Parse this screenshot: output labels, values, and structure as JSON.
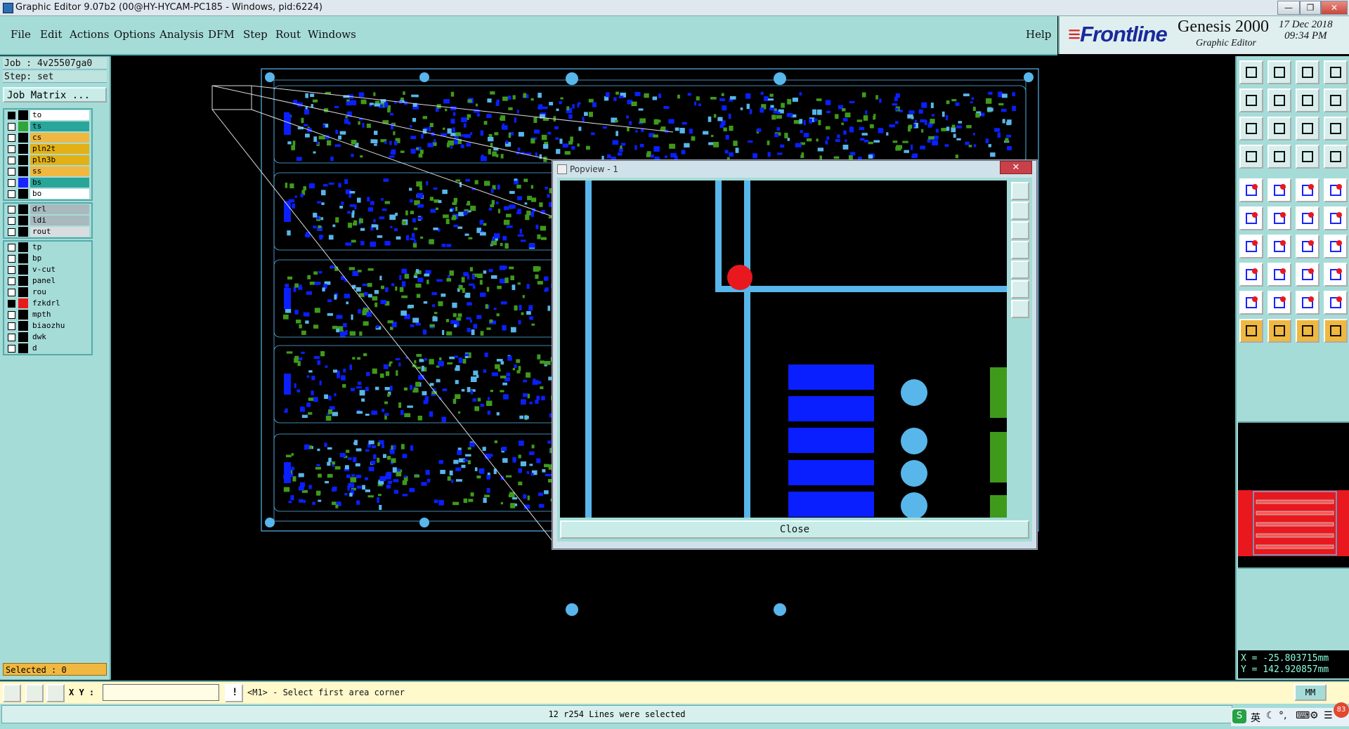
{
  "window": {
    "title": "Graphic Editor 9.07b2 (00@HY-HYCAM-PC185 - Windows, pid:6224)"
  },
  "menu": {
    "items": [
      "File",
      "Edit",
      "Actions",
      "Options",
      "Analysis",
      "DFM",
      "Step",
      "Rout",
      "Windows"
    ],
    "help": "Help"
  },
  "brand": {
    "logo": "Frontline",
    "product": "Genesis 2000",
    "subtitle": "Graphic Editor",
    "date": "17 Dec 2018",
    "time": "09:34 PM"
  },
  "job": {
    "job_line": "Job : 4v25507ga0",
    "step_line": "Step: set",
    "matrix_button": "Job Matrix ..."
  },
  "layers_group1": [
    {
      "name": "to",
      "checked": true,
      "color": "#000000",
      "bg": "#ffffff"
    },
    {
      "name": "ts",
      "checked": false,
      "color": "#2fa53c",
      "bg": "#2aa59a"
    },
    {
      "name": "cs",
      "checked": false,
      "color": "#000000",
      "bg": "#f0b840"
    },
    {
      "name": "pln2t",
      "checked": false,
      "color": "#000000",
      "bg": "#e3b015"
    },
    {
      "name": "pln3b",
      "checked": false,
      "color": "#000000",
      "bg": "#e3b015"
    },
    {
      "name": "ss",
      "checked": false,
      "color": "#000000",
      "bg": "#f0b840"
    },
    {
      "name": "bs",
      "checked": false,
      "color": "#1a22ff",
      "bg": "#2aa59a"
    },
    {
      "name": "bo",
      "checked": false,
      "color": "#000000",
      "bg": "#ffffff"
    }
  ],
  "layers_group2": [
    {
      "name": "drl",
      "checked": false,
      "color": "#000000",
      "bg": "#a9b9be"
    },
    {
      "name": "ldi",
      "checked": false,
      "color": "#000000",
      "bg": "#a9b9be"
    },
    {
      "name": "rout",
      "checked": false,
      "color": "#000000",
      "bg": "#d9dde0"
    }
  ],
  "layers_group3": [
    {
      "name": "tp",
      "checked": false,
      "color": "#000000",
      "bg": "#a5dcd8"
    },
    {
      "name": "bp",
      "checked": false,
      "color": "#000000",
      "bg": "#a5dcd8"
    },
    {
      "name": "v-cut",
      "checked": false,
      "color": "#000000",
      "bg": "#a5dcd8"
    },
    {
      "name": "panel",
      "checked": false,
      "color": "#000000",
      "bg": "#a5dcd8"
    },
    {
      "name": "rou",
      "checked": false,
      "color": "#000000",
      "bg": "#a5dcd8"
    },
    {
      "name": "fzkdrl",
      "checked": true,
      "color": "#e61a1a",
      "bg": "#a5dcd8"
    },
    {
      "name": "mpth",
      "checked": false,
      "color": "#000000",
      "bg": "#a5dcd8"
    },
    {
      "name": "biaozhu",
      "checked": false,
      "color": "#000000",
      "bg": "#a5dcd8"
    },
    {
      "name": "dwk",
      "checked": false,
      "color": "#000000",
      "bg": "#a5dcd8"
    },
    {
      "name": "d",
      "checked": false,
      "color": "#000000",
      "bg": "#a5dcd8"
    }
  ],
  "selected": "Selected : 0",
  "popview": {
    "title": "Popview - 1",
    "close_x": "✕",
    "close_label": "Close"
  },
  "command": {
    "xy_label": "X Y :",
    "xy_value": "",
    "prompt": "<M1> - Select first area corner",
    "units": "MM"
  },
  "coords": {
    "x": "X = -25.803715mm",
    "y": "Y = 142.920857mm"
  },
  "status": {
    "message": "12 r254 Lines were selected"
  },
  "ime": {
    "label": "英",
    "badge": "83"
  },
  "colors": {
    "panel": "#a5dcd8",
    "trace": "#58b6ea",
    "pad_blue": "#0a1fff",
    "pad_green": "#3f9a1c",
    "highlight": "#e8181e"
  }
}
